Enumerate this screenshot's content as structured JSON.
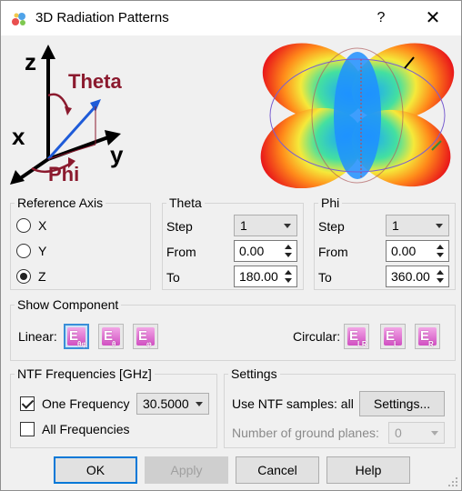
{
  "window": {
    "title": "3D Radiation Patterns",
    "help_label": "?",
    "close_label": "✕"
  },
  "axis_diagram": {
    "z": "z",
    "x": "x",
    "y": "y",
    "theta": "Theta",
    "phi": "Phi"
  },
  "reference_axis": {
    "title": "Reference Axis",
    "options": [
      "X",
      "Y",
      "Z"
    ],
    "selected": "Z"
  },
  "theta": {
    "title": "Theta",
    "step_label": "Step",
    "step_value": "1",
    "from_label": "From",
    "from_value": "0.00",
    "to_label": "To",
    "to_value": "180.00"
  },
  "phi": {
    "title": "Phi",
    "step_label": "Step",
    "step_value": "1",
    "from_label": "From",
    "from_value": "0.00",
    "to_label": "To",
    "to_value": "360.00"
  },
  "show_component": {
    "title": "Show Component",
    "linear_label": "Linear:",
    "circular_label": "Circular:",
    "linear_buttons": [
      {
        "main": "E",
        "sub": "θφ",
        "active": true
      },
      {
        "main": "E",
        "sub": "θ",
        "active": false
      },
      {
        "main": "E",
        "sub": "φ",
        "active": false
      }
    ],
    "circular_buttons": [
      {
        "main": "E",
        "sub": "LR"
      },
      {
        "main": "E",
        "sub": "L"
      },
      {
        "main": "E",
        "sub": "R"
      }
    ]
  },
  "ntf": {
    "title": "NTF Frequencies [GHz]",
    "one_frequency_label": "One Frequency",
    "one_frequency_checked": true,
    "frequency_value": "30.5000",
    "all_frequencies_label": "All Frequencies",
    "all_frequencies_checked": false
  },
  "settings": {
    "title": "Settings",
    "ntf_samples_label": "Use NTF samples: all",
    "settings_button": "Settings...",
    "ground_planes_label": "Number of ground planes:",
    "ground_planes_value": "0"
  },
  "buttons": {
    "ok": "OK",
    "apply": "Apply",
    "cancel": "Cancel",
    "help": "Help"
  },
  "colors": {
    "accent": "#0078d7",
    "diagram_red": "#8b1a2e",
    "diagram_blue": "#1e5bd8",
    "component_magenta": "#d14fc2"
  }
}
